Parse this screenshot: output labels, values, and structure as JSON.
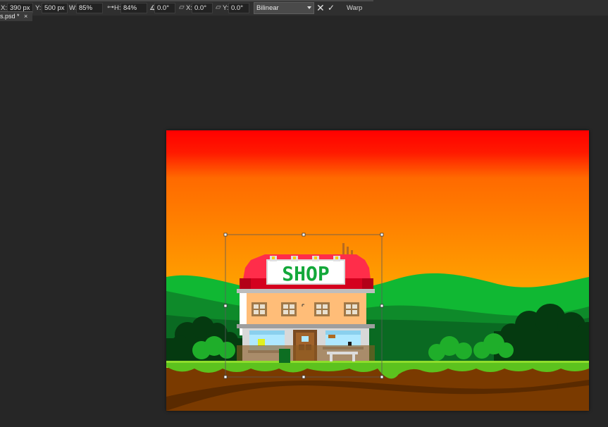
{
  "options_bar": {
    "x_label": "X:",
    "x_value": "390 px",
    "y_label": "Y:",
    "y_value": "500 px",
    "w_label": "W:",
    "w_value": "85%",
    "h_label": "H:",
    "h_value": "84%",
    "angle_label": "∡",
    "angle_value": "0.0°",
    "skew_h_label": "X:",
    "skew_h_value": "0.0°",
    "skew_v_label": "Y:",
    "skew_v_value": "0.0°",
    "interpolation": "Bilinear",
    "cancel_icon": "✕",
    "commit_icon": "✓",
    "warp_label": "Warp"
  },
  "document_tab": {
    "name": "s.psd *",
    "close": "×"
  },
  "artwork": {
    "sign_text": "SHOP"
  },
  "colors": {
    "sky_top": "#ff0000",
    "sky_mid": "#ff9500",
    "sky_bottom": "#ffd700",
    "grass": "#8fdc2c",
    "ground": "#7a3a00",
    "roof": "#ff2d4a",
    "sign_text": "#13a83a"
  }
}
